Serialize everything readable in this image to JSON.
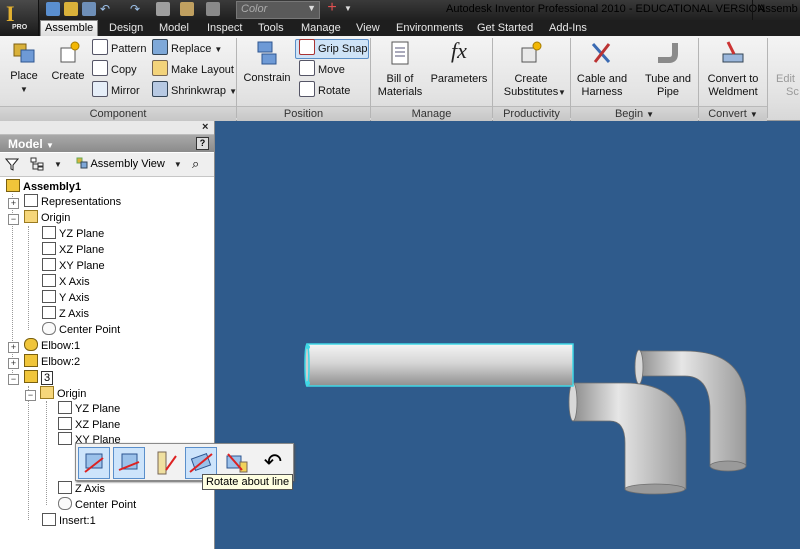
{
  "window": {
    "title": "Autodesk Inventor Professional 2010 - EDUCATIONAL VERSION",
    "title_right": "Assemb",
    "logo_letter": "I",
    "logo_badge": "PRO"
  },
  "quick_access": {
    "color_placeholder": "Color"
  },
  "tabs": [
    {
      "label": "Assemble",
      "active": true
    },
    {
      "label": "Design"
    },
    {
      "label": "Model"
    },
    {
      "label": "Inspect"
    },
    {
      "label": "Tools"
    },
    {
      "label": "Manage"
    },
    {
      "label": "View"
    },
    {
      "label": "Environments"
    },
    {
      "label": "Get Started"
    },
    {
      "label": "Add-Ins"
    }
  ],
  "ribbon": {
    "component": {
      "label": "Component",
      "place": "Place",
      "create": "Create",
      "pattern": "Pattern",
      "copy": "Copy",
      "mirror": "Mirror",
      "replace": "Replace",
      "make_layout": "Make Layout",
      "shrinkwrap": "Shrinkwrap"
    },
    "position": {
      "label": "Position",
      "constrain": "Constrain",
      "grip_snap": "Grip Snap",
      "move": "Move",
      "rotate": "Rotate"
    },
    "manage": {
      "label": "Manage",
      "bom_line1": "Bill of",
      "bom_line2": "Materials",
      "parameters": "Parameters",
      "fx_glyph": "fx"
    },
    "productivity": {
      "label": "Productivity",
      "line1": "Create",
      "line2": "Substitutes"
    },
    "begin": {
      "label": "Begin",
      "cable_line1": "Cable and",
      "cable_line2": "Harness",
      "tube_line1": "Tube and",
      "tube_line2": "Pipe"
    },
    "convert": {
      "label": "Convert",
      "line1": "Convert to",
      "line2": "Weldment"
    },
    "partial": {
      "line1": "Edit",
      "line2": "Sc"
    }
  },
  "browser": {
    "close_glyph": "×",
    "header": "Model",
    "help": "?",
    "view_mode": "Assembly View",
    "tree": [
      {
        "label": "Assembly1",
        "icon": "assembly-icon",
        "bold": true
      },
      {
        "label": "Representations",
        "icon": "representations-icon"
      },
      {
        "label": "Origin",
        "icon": "folder-icon"
      },
      {
        "label": "YZ Plane",
        "icon": "plane-icon"
      },
      {
        "label": "XZ Plane",
        "icon": "plane-icon"
      },
      {
        "label": "XY Plane",
        "icon": "plane-icon"
      },
      {
        "label": "X Axis",
        "icon": "axis-icon"
      },
      {
        "label": "Y Axis",
        "icon": "axis-icon"
      },
      {
        "label": "Z Axis",
        "icon": "axis-icon"
      },
      {
        "label": "Center Point",
        "icon": "point-icon"
      },
      {
        "label": "Elbow:1",
        "icon": "part-icon"
      },
      {
        "label": "Elbow:2",
        "icon": "part-icon"
      },
      {
        "label": "3",
        "icon": "part-icon",
        "editing": true
      },
      {
        "label": "Origin",
        "icon": "folder-icon"
      },
      {
        "label": "YZ Plane",
        "icon": "plane-icon"
      },
      {
        "label": "XZ Plane",
        "icon": "plane-icon"
      },
      {
        "label": "XY Plane",
        "icon": "plane-icon"
      },
      {
        "label": "Z Axis",
        "icon": "axis-icon"
      },
      {
        "label": "Center Point",
        "icon": "point-icon"
      },
      {
        "label": "Insert:1",
        "icon": "constraint-icon"
      }
    ]
  },
  "mini_toolbar": {
    "tooltip": "Rotate about line"
  },
  "colors": {
    "viewport": "#2f5b8c",
    "selection": "#3fd8e6",
    "highlight": "#cde4fb"
  }
}
